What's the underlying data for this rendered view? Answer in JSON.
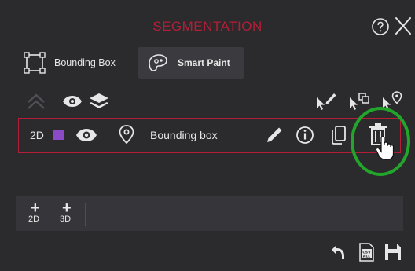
{
  "colors": {
    "title": "#b51e36",
    "accent_border": "#b51e36",
    "class_swatch": "#8b4bc6",
    "highlight": "#23a52b"
  },
  "header": {
    "title": "SEGMENTATION",
    "help_icon": "question-circle-icon",
    "close_icon": "close-icon"
  },
  "tools": [
    {
      "label": "Bounding Box",
      "icon": "bounding-box-icon",
      "active": false
    },
    {
      "label": "Smart Paint",
      "icon": "smart-paint-icon",
      "active": true
    }
  ],
  "toolbar": {
    "left_icons": [
      "chevron-up-icon",
      "eye-icon",
      "layers-icon"
    ],
    "right_icons": [
      "cursor-pencil-icon",
      "cursor-copy-icon",
      "cursor-pin-icon"
    ]
  },
  "item": {
    "dimension": "2D",
    "name": "Bounding box",
    "color": "#8b4bc6",
    "actions": [
      "pencil-icon",
      "info-icon",
      "copy-icon",
      "trash-icon"
    ]
  },
  "add_bar": {
    "buttons": [
      {
        "plus": "+",
        "label": "2D"
      },
      {
        "plus": "+",
        "label": "3D"
      }
    ]
  },
  "footer": {
    "csv_badge": [
      "CSV",
      "ALL"
    ],
    "icons": [
      "undo-icon",
      "csv-export-icon",
      "save-icon"
    ]
  }
}
